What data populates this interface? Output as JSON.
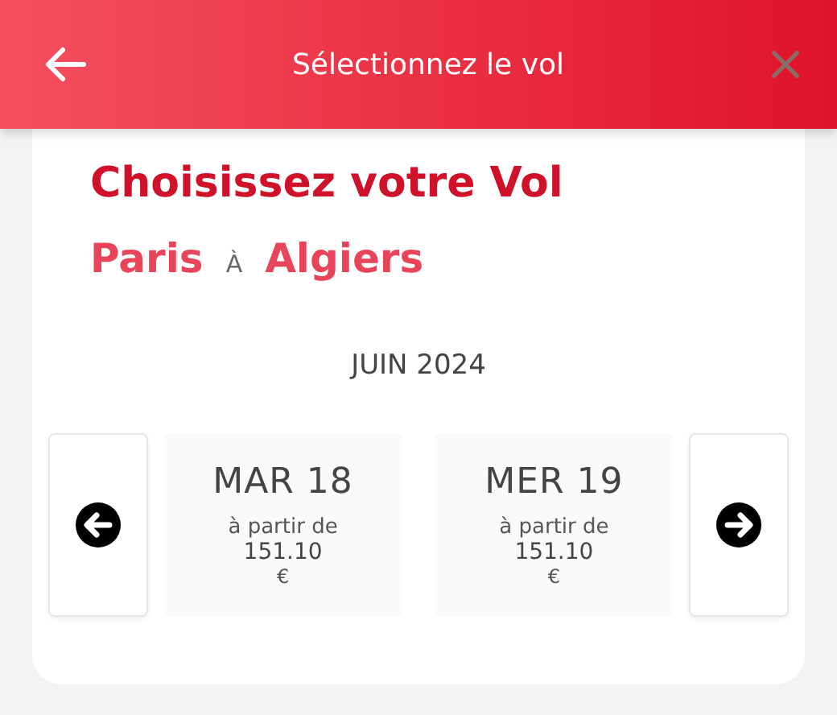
{
  "header": {
    "title": "Sélectionnez le vol"
  },
  "heading": "Choisissez votre Vol",
  "route": {
    "from": "Paris",
    "connector": "À",
    "to": "Algiers"
  },
  "month": "JUIN 2024",
  "dates": [
    {
      "day": "MAR 18",
      "from_label": "à partir de",
      "price": "151.10",
      "currency": "€"
    },
    {
      "day": "MER 19",
      "from_label": "à partir de",
      "price": "151.10",
      "currency": "€"
    }
  ]
}
